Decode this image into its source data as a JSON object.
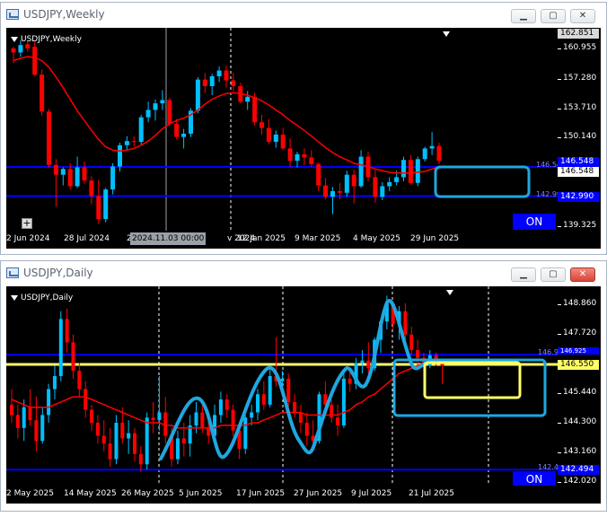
{
  "weekly": {
    "title": "USDJPY,Weekly",
    "symbol_label": "USDJPY,Weekly",
    "price_labels": [
      "162.851",
      "160.955",
      "157.280",
      "153.710",
      "150.140",
      "146.548",
      "146.548",
      "142.990",
      "139.325"
    ],
    "current_price_box": "162.851",
    "hline_labels": [
      "146.548",
      "142.990"
    ],
    "date_labels": [
      "2 Jun 2024",
      "28 Jul 2024",
      "22 Sep 2024",
      "17 Nov 2024",
      "12 Jan 2025",
      "9 Mar 2025",
      "4 May 2025",
      "29 Jun 2025"
    ],
    "crosshair_tooltip": "2024.11.03 00:00",
    "on_button": "ON",
    "colors": {
      "bull": "#00bfff",
      "bear": "#ff0000",
      "ma": "#ff0000",
      "hline": "#0000ff",
      "highlight": "#1ea7e0"
    },
    "candles": [
      [
        161.0,
        161.2,
        159.2,
        160.5
      ],
      [
        160.5,
        162.0,
        160.0,
        161.4
      ],
      [
        161.5,
        161.9,
        160.6,
        161.0
      ],
      [
        161.2,
        161.8,
        157.6,
        157.8
      ],
      [
        157.8,
        158.4,
        152.8,
        153.3
      ],
      [
        153.3,
        153.6,
        146.5,
        146.8
      ],
      [
        146.8,
        147.5,
        141.7,
        145.6
      ],
      [
        145.6,
        146.5,
        144.3,
        146.3
      ],
      [
        146.3,
        147.0,
        143.8,
        144.2
      ],
      [
        144.2,
        147.8,
        144.0,
        146.5
      ],
      [
        146.5,
        147.2,
        144.5,
        144.9
      ],
      [
        144.9,
        145.4,
        142.0,
        143.0
      ],
      [
        143.0,
        145.0,
        139.6,
        140.2
      ],
      [
        140.2,
        144.0,
        139.8,
        143.8
      ],
      [
        143.8,
        147.0,
        143.2,
        146.6
      ],
      [
        146.6,
        149.5,
        146.0,
        149.2
      ],
      [
        149.2,
        150.3,
        148.6,
        149.7
      ],
      [
        149.7,
        150.3,
        149.0,
        149.6
      ],
      [
        149.6,
        152.9,
        149.3,
        152.6
      ],
      [
        152.6,
        154.5,
        152.0,
        153.5
      ],
      [
        153.5,
        154.8,
        152.2,
        154.3
      ],
      [
        154.3,
        155.9,
        153.5,
        154.7
      ],
      [
        154.7,
        155.0,
        151.5,
        151.8
      ],
      [
        151.8,
        152.4,
        149.9,
        150.2
      ],
      [
        150.2,
        151.2,
        148.8,
        150.6
      ],
      [
        150.6,
        153.7,
        150.2,
        153.4
      ],
      [
        153.4,
        157.5,
        153.1,
        157.2
      ],
      [
        157.2,
        158.0,
        155.6,
        156.4
      ],
      [
        156.4,
        157.9,
        155.3,
        157.6
      ],
      [
        157.6,
        158.8,
        156.9,
        158.3
      ],
      [
        158.3,
        158.9,
        156.2,
        157.1
      ],
      [
        157.1,
        158.0,
        155.8,
        156.4
      ],
      [
        156.4,
        156.8,
        154.3,
        154.5
      ],
      [
        154.5,
        155.8,
        153.5,
        155.1
      ],
      [
        155.1,
        155.6,
        151.6,
        152.0
      ],
      [
        152.0,
        152.9,
        150.5,
        151.3
      ],
      [
        151.3,
        152.4,
        149.3,
        149.6
      ],
      [
        149.6,
        151.0,
        148.9,
        150.5
      ],
      [
        150.5,
        151.3,
        148.6,
        148.8
      ],
      [
        148.8,
        150.0,
        146.6,
        147.3
      ],
      [
        147.3,
        148.4,
        146.5,
        148.1
      ],
      [
        148.1,
        148.8,
        146.8,
        147.7
      ],
      [
        147.7,
        148.6,
        146.6,
        146.9
      ],
      [
        146.9,
        147.1,
        143.6,
        144.3
      ],
      [
        144.3,
        145.2,
        142.6,
        142.9
      ],
      [
        142.9,
        144.1,
        140.8,
        143.6
      ],
      [
        143.6,
        144.6,
        142.6,
        143.4
      ],
      [
        143.4,
        146.1,
        142.9,
        145.6
      ],
      [
        145.6,
        146.2,
        142.1,
        144.2
      ],
      [
        144.2,
        148.6,
        144.0,
        147.8
      ],
      [
        147.8,
        148.4,
        144.8,
        145.3
      ],
      [
        145.3,
        146.2,
        142.2,
        142.9
      ],
      [
        142.9,
        144.7,
        142.5,
        144.2
      ],
      [
        144.2,
        145.3,
        143.6,
        144.7
      ],
      [
        144.7,
        146.1,
        144.3,
        145.3
      ],
      [
        145.3,
        147.8,
        144.8,
        147.4
      ],
      [
        147.4,
        148.0,
        144.4,
        144.6
      ],
      [
        144.6,
        147.8,
        144.2,
        147.5
      ],
      [
        147.5,
        149.0,
        147.2,
        148.8
      ],
      [
        148.8,
        150.8,
        148.0,
        149.1
      ],
      [
        149.1,
        149.5,
        146.9,
        147.3
      ]
    ],
    "ma": [
      159.5,
      159.8,
      160.0,
      159.9,
      159.5,
      158.7,
      157.5,
      156.2,
      154.8,
      153.4,
      152.2,
      151.0,
      149.9,
      149.0,
      148.6,
      148.5,
      148.6,
      148.8,
      149.2,
      149.7,
      150.4,
      151.2,
      151.8,
      152.2,
      152.5,
      152.9,
      153.5,
      154.2,
      154.8,
      155.2,
      155.5,
      155.6,
      155.5,
      155.3,
      155.0,
      154.6,
      154.1,
      153.5,
      152.9,
      152.2,
      151.6,
      151.0,
      150.3,
      149.6,
      148.9,
      148.3,
      147.8,
      147.4,
      147.0,
      146.8,
      146.6,
      146.3,
      146.1,
      145.9,
      145.8,
      145.8,
      145.8,
      145.9,
      146.0,
      146.3,
      146.5
    ]
  },
  "daily": {
    "title": "USDJPY,Daily",
    "symbol_label": "USDJPY,Daily",
    "price_labels": [
      "148.860",
      "147.720",
      "146.550",
      "145.440",
      "144.300",
      "143.160",
      "142.020"
    ],
    "hline_labels": [
      "146.925",
      "142.494"
    ],
    "current_price_box": "146.550",
    "date_labels": [
      "2 May 2025",
      "14 May 2025",
      "26 May 2025",
      "5 Jun 2025",
      "17 Jun 2025",
      "27 Jun 2025",
      "9 Jul 2025",
      "21 Jul 2025"
    ],
    "on_button": "ON",
    "colors": {
      "bull": "#00bfff",
      "bear": "#ff0000",
      "ma": "#ff0000",
      "hline": "#0000ff",
      "yellow": "#ffff66",
      "highlight": "#1ea7e0"
    },
    "candles": [
      [
        145.0,
        145.6,
        144.3,
        144.6
      ],
      [
        144.6,
        145.0,
        143.7,
        144.1
      ],
      [
        144.1,
        145.2,
        143.6,
        144.9
      ],
      [
        144.9,
        145.6,
        144.2,
        144.4
      ],
      [
        144.4,
        145.3,
        143.2,
        143.6
      ],
      [
        143.6,
        144.9,
        143.5,
        144.6
      ],
      [
        144.6,
        145.8,
        144.3,
        145.6
      ],
      [
        145.6,
        146.5,
        145.2,
        146.1
      ],
      [
        146.1,
        148.6,
        145.9,
        148.3
      ],
      [
        148.3,
        148.7,
        147.0,
        147.4
      ],
      [
        147.4,
        147.7,
        146.0,
        146.3
      ],
      [
        146.3,
        146.6,
        145.3,
        145.6
      ],
      [
        145.6,
        145.9,
        144.5,
        144.8
      ],
      [
        144.8,
        145.0,
        144.0,
        144.3
      ],
      [
        144.3,
        144.6,
        143.5,
        143.8
      ],
      [
        143.8,
        144.4,
        143.2,
        143.5
      ],
      [
        143.5,
        144.1,
        142.6,
        142.9
      ],
      [
        142.9,
        144.6,
        142.7,
        144.3
      ],
      [
        144.3,
        144.9,
        143.5,
        143.7
      ],
      [
        143.7,
        144.4,
        143.1,
        143.9
      ],
      [
        143.9,
        144.1,
        142.8,
        143.1
      ],
      [
        143.1,
        143.4,
        142.4,
        142.7
      ],
      [
        142.7,
        144.7,
        142.5,
        144.5
      ],
      [
        144.5,
        145.1,
        143.9,
        144.4
      ],
      [
        144.4,
        146.1,
        144.0,
        144.7
      ],
      [
        144.7,
        145.3,
        143.5,
        143.8
      ],
      [
        143.8,
        144.1,
        142.6,
        142.9
      ],
      [
        142.9,
        144.0,
        142.7,
        143.7
      ],
      [
        143.7,
        144.3,
        143.0,
        143.5
      ],
      [
        143.5,
        144.6,
        143.0,
        144.2
      ],
      [
        144.2,
        145.1,
        143.9,
        144.7
      ],
      [
        144.7,
        145.0,
        143.9,
        144.1
      ],
      [
        144.1,
        144.6,
        143.5,
        143.8
      ],
      [
        143.8,
        145.0,
        143.6,
        144.6
      ],
      [
        144.6,
        145.5,
        144.3,
        145.2
      ],
      [
        145.2,
        145.4,
        144.5,
        144.8
      ],
      [
        144.8,
        145.0,
        143.8,
        144.0
      ],
      [
        144.0,
        144.3,
        142.9,
        143.3
      ],
      [
        143.3,
        144.6,
        143.1,
        144.5
      ],
      [
        144.5,
        145.0,
        144.2,
        144.7
      ],
      [
        144.7,
        145.6,
        144.4,
        145.4
      ],
      [
        145.4,
        145.9,
        144.8,
        145.0
      ],
      [
        145.0,
        146.4,
        144.9,
        146.1
      ],
      [
        146.1,
        147.6,
        145.7,
        145.9
      ],
      [
        145.9,
        146.3,
        145.4,
        146.0
      ],
      [
        146.0,
        146.2,
        144.9,
        145.1
      ],
      [
        145.1,
        145.4,
        144.5,
        144.7
      ],
      [
        144.7,
        145.0,
        143.9,
        144.3
      ],
      [
        144.3,
        144.7,
        143.4,
        143.8
      ],
      [
        143.8,
        144.4,
        143.3,
        143.6
      ],
      [
        143.6,
        145.5,
        143.5,
        145.4
      ],
      [
        145.4,
        145.9,
        144.8,
        145.0
      ],
      [
        145.0,
        145.2,
        144.3,
        144.5
      ],
      [
        144.5,
        145.0,
        143.8,
        144.2
      ],
      [
        144.2,
        146.3,
        144.1,
        146.0
      ],
      [
        146.0,
        146.4,
        145.5,
        145.8
      ],
      [
        145.8,
        146.8,
        145.6,
        146.6
      ],
      [
        146.6,
        147.1,
        146.2,
        146.7
      ],
      [
        146.7,
        147.4,
        146.2,
        146.4
      ],
      [
        146.4,
        147.6,
        146.3,
        147.5
      ],
      [
        147.5,
        148.3,
        147.0,
        148.2
      ],
      [
        148.2,
        149.2,
        147.9,
        148.9
      ],
      [
        148.9,
        149.0,
        147.9,
        148.1
      ],
      [
        148.1,
        148.8,
        147.5,
        148.6
      ],
      [
        148.6,
        148.9,
        147.4,
        147.7
      ],
      [
        147.7,
        148.0,
        146.9,
        147.1
      ],
      [
        147.1,
        147.5,
        146.5,
        146.8
      ],
      [
        146.8,
        147.0,
        146.1,
        146.5
      ],
      [
        146.5,
        147.1,
        146.4,
        146.9
      ],
      [
        146.9,
        147.0,
        146.5,
        146.6
      ],
      [
        146.6,
        146.7,
        145.8,
        146.5
      ]
    ],
    "ma": [
      145.2,
      145.1,
      145.0,
      144.9,
      144.9,
      144.9,
      144.9,
      145.0,
      145.1,
      145.2,
      145.3,
      145.3,
      145.3,
      145.2,
      145.1,
      145.0,
      144.9,
      144.8,
      144.7,
      144.6,
      144.5,
      144.4,
      144.3,
      144.3,
      144.3,
      144.2,
      144.2,
      144.1,
      144.1,
      144.1,
      144.1,
      144.1,
      144.1,
      144.1,
      144.2,
      144.2,
      144.2,
      144.2,
      144.2,
      144.3,
      144.3,
      144.4,
      144.5,
      144.6,
      144.7,
      144.7,
      144.7,
      144.7,
      144.6,
      144.6,
      144.6,
      144.6,
      144.6,
      144.6,
      144.7,
      144.8,
      145.0,
      145.1,
      145.3,
      145.4,
      145.6,
      145.8,
      146.0,
      146.2,
      146.3,
      146.4,
      146.5,
      146.6,
      146.6,
      146.7,
      146.7
    ]
  }
}
